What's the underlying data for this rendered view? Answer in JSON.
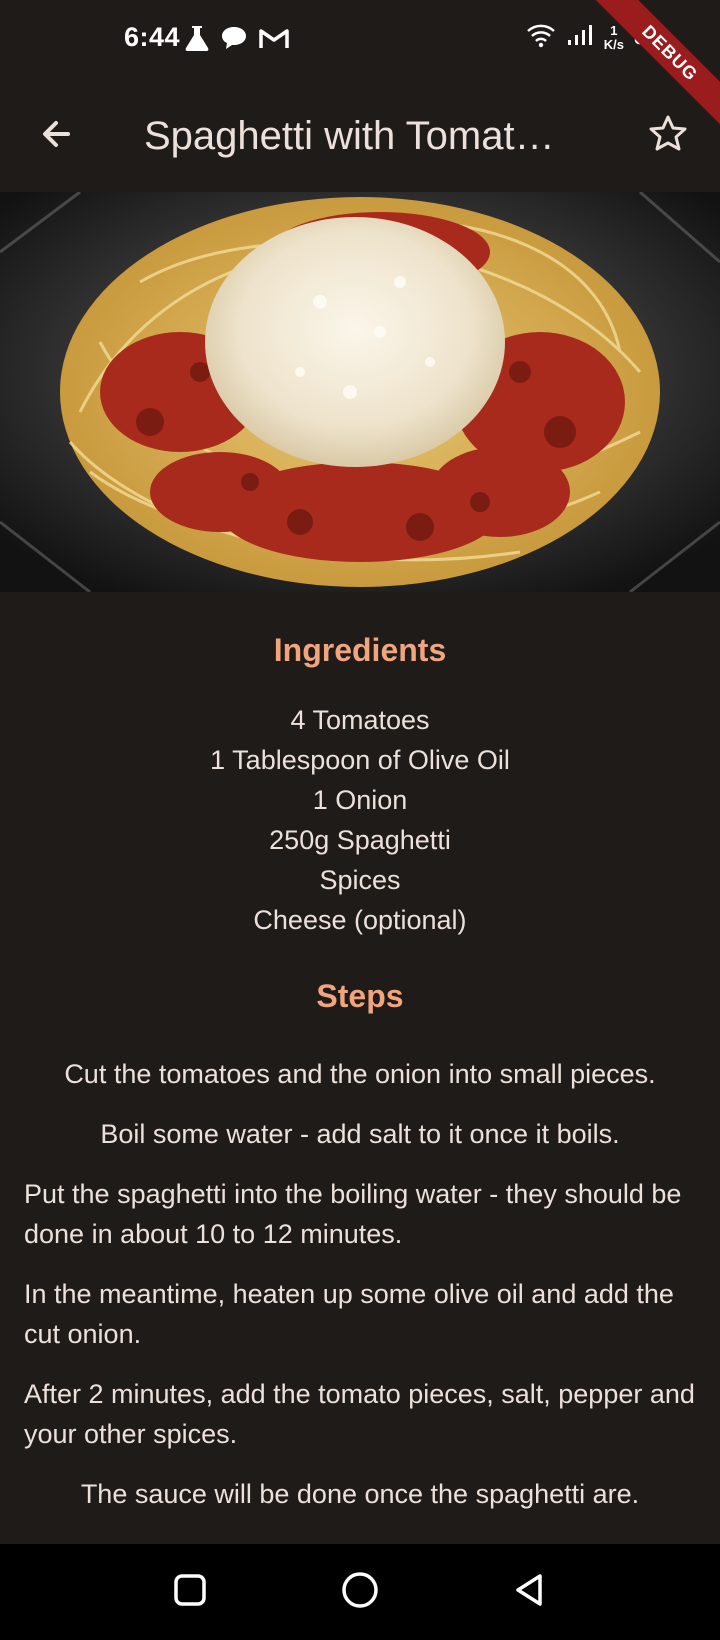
{
  "status_bar": {
    "time": "6:44",
    "left_icons": [
      "flask-icon",
      "chat-icon",
      "gmail-icon"
    ],
    "right_icons": [
      "wifi-icon",
      "signal-icon",
      "battery-icon"
    ],
    "net_speed_value": "1",
    "net_speed_unit": "K/s"
  },
  "debug_banner": "DEBUG",
  "app_bar": {
    "title": "Spaghetti with Tomat…",
    "back_icon": "arrow-back-icon",
    "favorite_icon": "star-outline-icon"
  },
  "ingredients": {
    "heading": "Ingredients",
    "items": [
      "4 Tomatoes",
      "1 Tablespoon of Olive Oil",
      "1 Onion",
      "250g Spaghetti",
      "Spices",
      "Cheese (optional)"
    ]
  },
  "steps": {
    "heading": "Steps",
    "items": [
      "Cut the tomatoes and the onion into small pieces.",
      "Boil some water - add salt to it once it boils.",
      "Put the spaghetti into the boiling water - they should be done in about 10 to 12 minutes.",
      "In the meantime, heaten up some olive oil and add the cut onion.",
      "After 2 minutes, add the tomato pieces, salt, pepper and your other spices.",
      "The sauce will be done once the spaghetti are."
    ]
  },
  "nav_bar": {
    "icons": [
      "recents-square-icon",
      "home-circle-icon",
      "back-triangle-icon"
    ]
  },
  "colors": {
    "background": "#1f1b19",
    "heading_accent": "#f0a57f",
    "text": "#ece0da",
    "debug_banner": "#9b1c1c"
  }
}
